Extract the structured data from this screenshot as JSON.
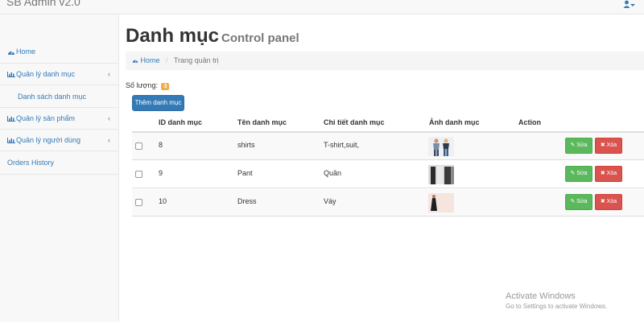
{
  "app": {
    "brand": "SB Admin v2.0"
  },
  "sidebar": {
    "items": [
      {
        "label": "Home",
        "icon": "dashboard-icon"
      },
      {
        "label": "Quản lý danh mục",
        "icon": "bar-chart-icon"
      },
      {
        "label": "Danh sách danh mục"
      },
      {
        "label": "Quản lý sản phẩm",
        "icon": "bar-chart-icon"
      },
      {
        "label": "Quản lý người dùng",
        "icon": "bar-chart-icon"
      },
      {
        "label": "Orders History"
      }
    ],
    "caret": "‹"
  },
  "page": {
    "title": "Danh mục",
    "subtitle": "Control panel"
  },
  "breadcrumb": {
    "home": "Home",
    "separator": "/",
    "current": "Trang quản trị"
  },
  "summary": {
    "label": "Số lượng:",
    "count": "3"
  },
  "toolbar": {
    "add_label": "Thêm danh mục"
  },
  "table": {
    "headers": [
      "ID danh mục",
      "Tên danh mục",
      "Chi tiết danh mục",
      "Ảnh danh mục",
      "Action"
    ],
    "rows": [
      {
        "id": "8",
        "name": "shirts",
        "detail": "T-shirt,suit,",
        "image": "shirts-thumbnail"
      },
      {
        "id": "9",
        "name": "Pant",
        "detail": "Quần",
        "image": "pants-thumbnail"
      },
      {
        "id": "10",
        "name": "Dress",
        "detail": "Váy",
        "image": "dress-thumbnail"
      }
    ],
    "edit_label": "Sửa",
    "delete_label": "Xóa"
  },
  "watermark": {
    "line1": "Activate Windows",
    "line2": "Go to Settings to activate Windows."
  },
  "colors": {
    "primary": "#337ab7",
    "success": "#5cb85c",
    "danger": "#d9534f",
    "warning": "#f0ad4e"
  }
}
